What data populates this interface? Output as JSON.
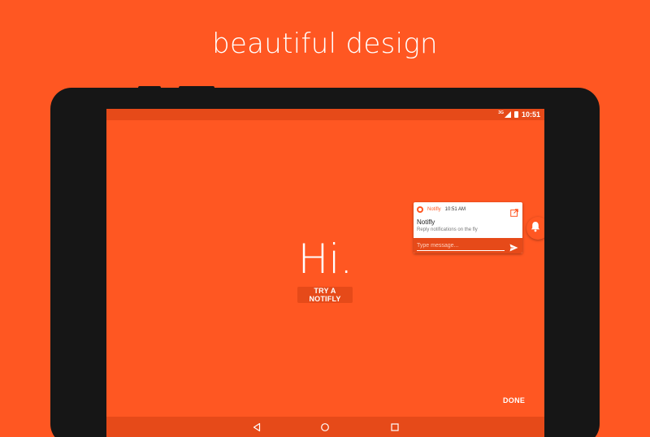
{
  "headline": "beautiful design",
  "status_bar": {
    "network": "3G",
    "time": "10:51"
  },
  "main": {
    "greeting": "Hi.",
    "try_button": "TRY A NOTIFLY",
    "done_button": "DONE"
  },
  "notification": {
    "app_name": "Notifly",
    "time": "10:51 AM",
    "title": "Notifly",
    "text": "Reply notifications on the fly",
    "reply_placeholder": "Type message..."
  },
  "icons": {
    "app": "notifly-app-icon",
    "open": "open-in-new-icon",
    "send": "send-icon",
    "bell": "bell-icon",
    "back": "back-icon",
    "home": "home-icon",
    "recents": "recents-icon"
  },
  "colors": {
    "background": "#ff5722",
    "dark_accent": "#e64a19",
    "device": "#161616"
  }
}
